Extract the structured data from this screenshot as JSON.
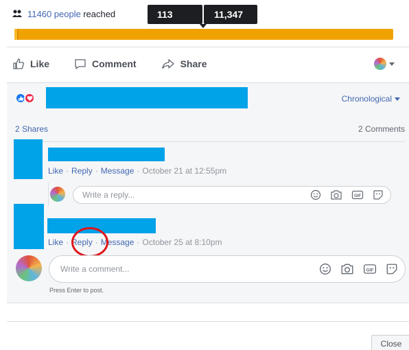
{
  "reach": {
    "count_text": "11460 people reached",
    "reached_label": "reached",
    "people_label": "11460 people"
  },
  "tooltip": {
    "left_value": "113",
    "right_value": "11,347"
  },
  "progress": {
    "fraction": 0.01,
    "color": "#f0a202"
  },
  "actions": {
    "like": "Like",
    "comment": "Comment",
    "share": "Share"
  },
  "reactions": {
    "sort_label": "Chronological"
  },
  "counts": {
    "shares": "2 Shares",
    "comments": "2 Comments"
  },
  "comments": [
    {
      "like": "Like",
      "reply": "Reply",
      "message": "Message",
      "time": "October 21 at 12:55pm"
    },
    {
      "like": "Like",
      "reply": "Reply",
      "message": "Message",
      "time": "October 25 at 8:10pm"
    }
  ],
  "reply_box": {
    "placeholder": "Write a reply..."
  },
  "comment_box": {
    "placeholder": "Write a comment...",
    "hint": "Press Enter to post."
  },
  "footer": {
    "close": "Close"
  },
  "colors": {
    "link": "#4267b2",
    "redaction": "#00a2e8",
    "annotation": "#e0151b"
  },
  "icons": [
    "people-icon",
    "thumbs-up-icon",
    "comment-icon",
    "share-icon",
    "emoji-icon",
    "camera-icon",
    "gif-icon",
    "sticker-icon"
  ]
}
